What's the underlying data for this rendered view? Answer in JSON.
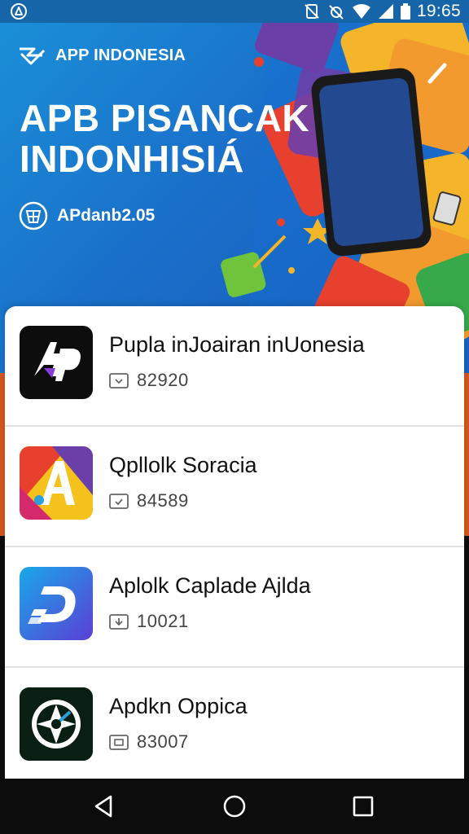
{
  "status_bar": {
    "time": "19:65",
    "icons": [
      "app-notification-icon",
      "silent-icon",
      "alarm-icon",
      "wifi-icon",
      "signal-icon",
      "battery-icon"
    ]
  },
  "hero": {
    "brand": "APP INDONESIA",
    "title_line1": "APB PISANCAK",
    "title_line2": "INDONHISIÁ",
    "subtitle": "APdanb2.05",
    "colors": {
      "background": "#1a7fd0",
      "accent_red": "#e8402e",
      "accent_yellow": "#f4b52a",
      "accent_green": "#6fc43c",
      "accent_purple": "#6b3fa8"
    }
  },
  "apps": [
    {
      "name": "Pupla inJoairan inUonesia",
      "count": "82920",
      "icon": "ap-logo-icon"
    },
    {
      "name": "Qpllolk Soracia",
      "count": "84589",
      "icon": "a-letter-icon"
    },
    {
      "name": "Aplolk Caplade Ajlda",
      "count": "10021",
      "icon": "d-swoosh-icon"
    },
    {
      "name": "Apdkn Oppica",
      "count": "83007",
      "icon": "aperture-icon"
    }
  ],
  "nav": {
    "back": "back-icon",
    "home": "home-icon",
    "recents": "recents-icon"
  }
}
